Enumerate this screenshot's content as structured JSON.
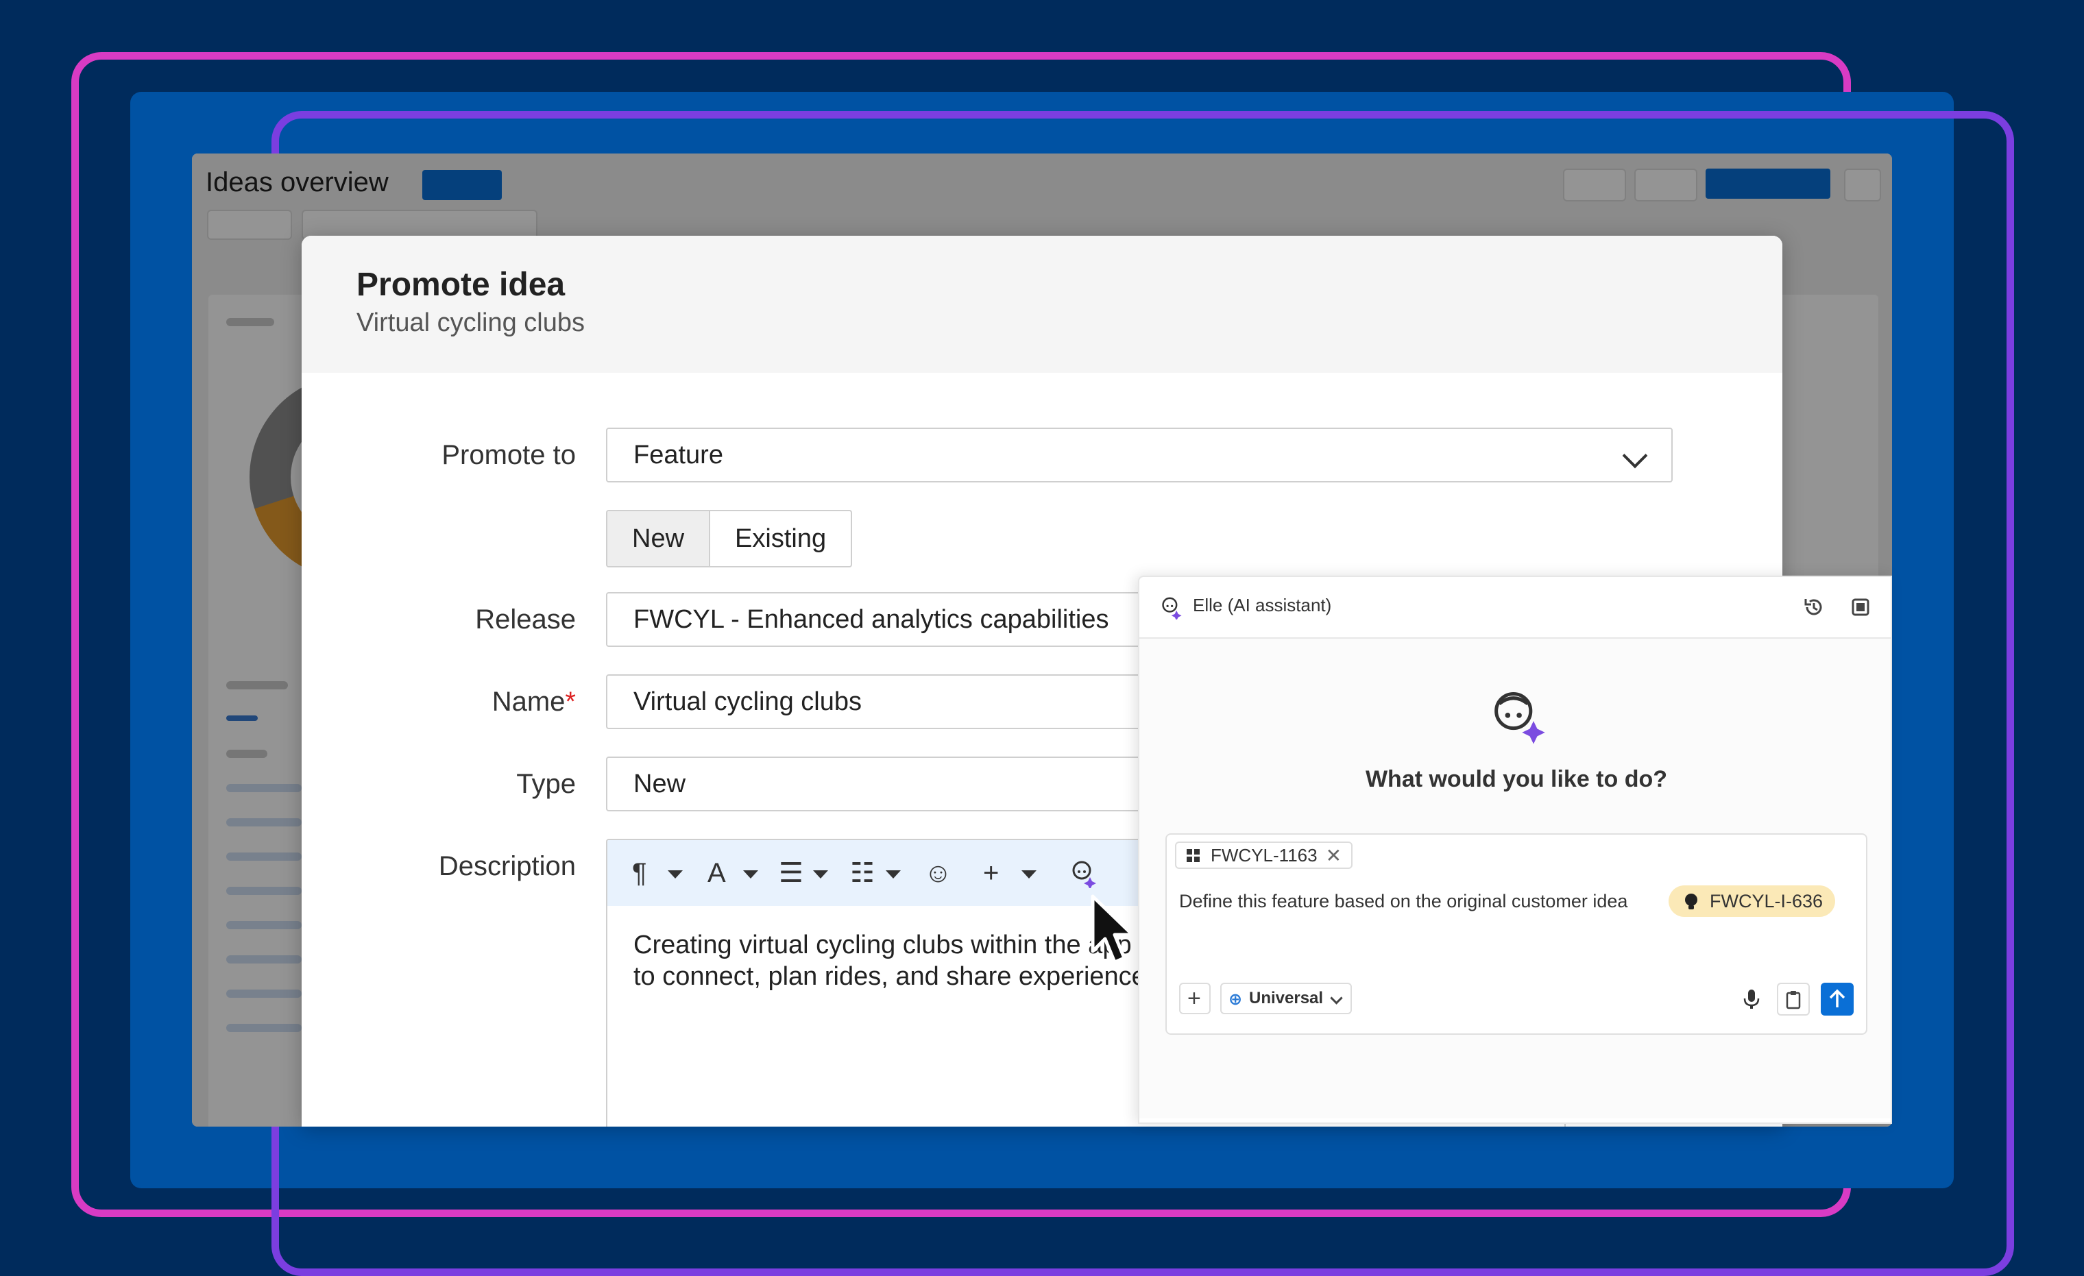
{
  "background_app": {
    "title": "Ideas overview"
  },
  "modal": {
    "title": "Promote idea",
    "subtitle": "Virtual cycling clubs",
    "promote_to": {
      "label": "Promote to",
      "value": "Feature"
    },
    "toggle": {
      "options": [
        "New",
        "Existing"
      ],
      "selected": "New"
    },
    "release": {
      "label": "Release",
      "value": "FWCYL - Enhanced analytics capabilities"
    },
    "name": {
      "label": "Name",
      "required_mark": "*",
      "value": "Virtual cycling clubs"
    },
    "type": {
      "label": "Type",
      "value": "New"
    },
    "description": {
      "label": "Description",
      "text_line1": "Creating virtual cycling clubs within the app",
      "text_line2": "to connect, plan rides, and share experiences"
    }
  },
  "ai_panel": {
    "title": "Elle (AI assistant)",
    "question": "What would you like to do?",
    "context_tag": "FWCYL-1163",
    "prompt_text": "Define this feature based on the original customer idea",
    "idea_chip": "FWCYL-I-636",
    "mode": "Universal"
  },
  "colors": {
    "background": "#002b5c",
    "frame_pink": "#d83bc4",
    "frame_purple": "#7b3ee0",
    "accent_blue": "#0a6fd6",
    "idea_chip": "#fbe9b7"
  }
}
